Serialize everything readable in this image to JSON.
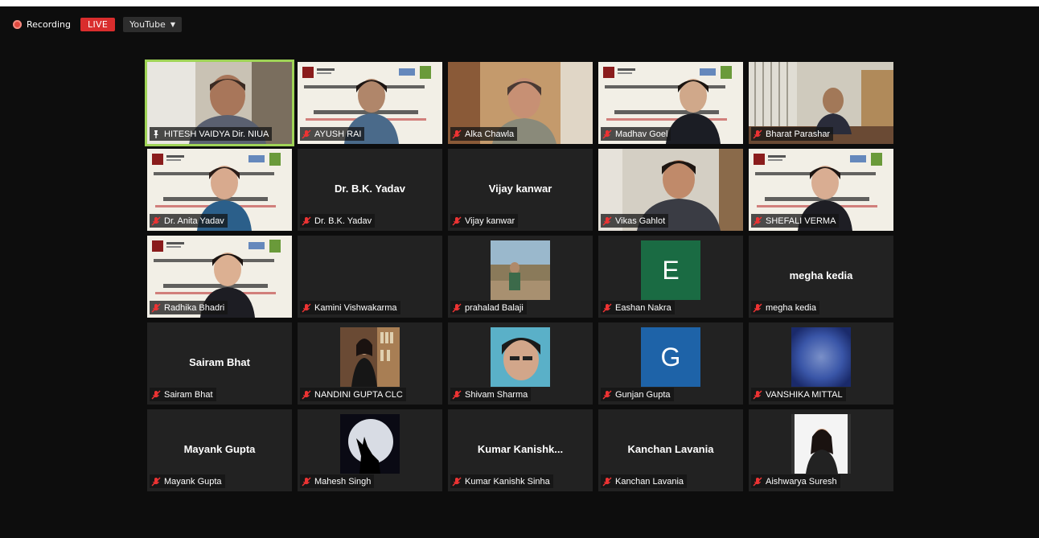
{
  "topbar": {
    "recording_label": "Recording",
    "live_label": "LIVE",
    "stream_target": "YouTube",
    "live_color": "#d92d2d"
  },
  "colors": {
    "active_speaker_border": "#9fd356",
    "tile_bg": "#222222",
    "avatar_e": "#1a6b43",
    "avatar_g": "#1e63a8"
  },
  "participants": [
    {
      "name": "HITESH VAIDYA Dir. NIUA",
      "tile": "video",
      "video": "man-office",
      "muted": false,
      "pinned": true,
      "active_speaker": true
    },
    {
      "name": "AYUSH RAI",
      "tile": "video",
      "video": "banner-man",
      "muted": true
    },
    {
      "name": "Alka Chawla",
      "tile": "video",
      "video": "woman-room",
      "muted": true
    },
    {
      "name": "Madhav Goel",
      "tile": "video",
      "video": "banner-man-suit",
      "muted": true
    },
    {
      "name": "Bharat Parashar",
      "tile": "video",
      "video": "office-man",
      "muted": true
    },
    {
      "name": "Dr. Anita Yadav",
      "tile": "video",
      "video": "banner-woman",
      "muted": true
    },
    {
      "name": "Dr. B.K. Yadav",
      "tile": "name",
      "display": "Dr. B.K. Yadav",
      "muted": true
    },
    {
      "name": "Vijay kanwar",
      "tile": "name",
      "display": "Vijay kanwar",
      "muted": true
    },
    {
      "name": "Vikas Gahlot",
      "tile": "video",
      "video": "man-shelves",
      "muted": true
    },
    {
      "name": "SHEFALI VERMA",
      "tile": "video",
      "video": "banner-woman-2",
      "muted": true
    },
    {
      "name": "Radhika Bhadri",
      "tile": "video",
      "video": "banner-woman-3",
      "muted": true
    },
    {
      "name": "Kamini Vishwakarma",
      "tile": "blank",
      "muted": true
    },
    {
      "name": "prahalad Balaji",
      "tile": "photo",
      "photo": "outdoor-man",
      "muted": true
    },
    {
      "name": "Eashan Nakra",
      "tile": "avatar",
      "letter": "E",
      "color": "#1a6b43",
      "muted": true
    },
    {
      "name": "megha kedia",
      "tile": "name",
      "display": "megha kedia",
      "muted": true
    },
    {
      "name": "Sairam Bhat",
      "tile": "name",
      "display": "Sairam Bhat",
      "muted": true
    },
    {
      "name": "NANDINI GUPTA CLC",
      "tile": "photo",
      "photo": "woman-bookshelf",
      "muted": true
    },
    {
      "name": "Shivam Sharma",
      "tile": "photo",
      "photo": "man-selfie",
      "muted": true
    },
    {
      "name": "Gunjan Gupta",
      "tile": "avatar",
      "letter": "G",
      "color": "#1e63a8",
      "muted": true
    },
    {
      "name": "VANSHIKA MITTAL",
      "tile": "photo",
      "photo": "blurred-blue",
      "muted": true
    },
    {
      "name": "Mayank Gupta",
      "tile": "name",
      "display": "Mayank Gupta",
      "muted": true
    },
    {
      "name": "Mahesh Singh",
      "tile": "photo",
      "photo": "wolf-moon",
      "muted": true
    },
    {
      "name": "Kumar Kanishk Sinha",
      "tile": "name",
      "display": "Kumar  Kanishk...",
      "muted": true
    },
    {
      "name": "Kanchan Lavania",
      "tile": "name",
      "display": "Kanchan Lavania",
      "muted": true
    },
    {
      "name": "Aishwarya Suresh",
      "tile": "photo",
      "photo": "woman-portrait",
      "muted": true
    }
  ]
}
